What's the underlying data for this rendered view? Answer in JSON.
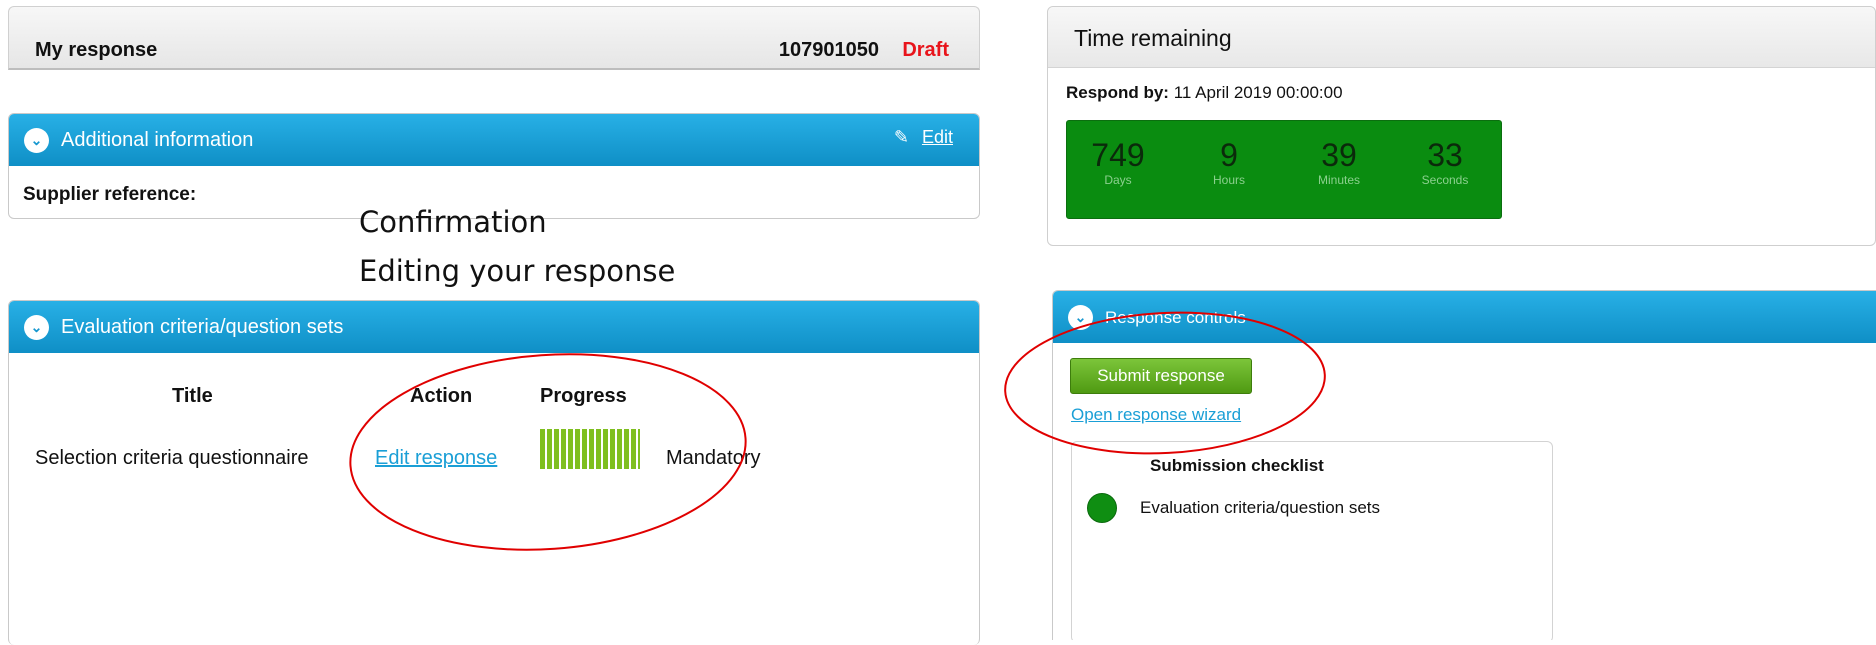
{
  "my_response": {
    "title": "My response",
    "number": "107901050",
    "status": "Draft"
  },
  "additional_info": {
    "title": "Additional information",
    "edit_label": "Edit",
    "supplier_label": "Supplier reference:"
  },
  "overlay": {
    "line1": "Confirmation",
    "line2": "Editing your response"
  },
  "evaluation": {
    "title": "Evaluation criteria/question sets",
    "columns": {
      "title": "Title",
      "action": "Action",
      "progress": "Progress"
    },
    "row": {
      "title": "Selection criteria questionnaire",
      "action": "Edit response",
      "status": "Mandatory",
      "progress_fraction": 1.0
    }
  },
  "time_remaining": {
    "title": "Time remaining",
    "respond_by_label": "Respond by:",
    "respond_by_value": "11 April 2019 00:00:00",
    "days": "749",
    "days_label": "Days",
    "hours": "9",
    "hours_label": "Hours",
    "minutes": "39",
    "minutes_label": "Minutes",
    "seconds": "33",
    "seconds_label": "Seconds"
  },
  "response_controls": {
    "title": "Response controls",
    "submit_label": "Submit response",
    "wizard_label": "Open response wizard",
    "checklist_title": "Submission checklist",
    "checklist_item": "Evaluation criteria/question sets"
  },
  "colors": {
    "panel_blue": "#1597cf",
    "draft_red": "#e8141b",
    "countdown_green": "#0a8c10",
    "progress_green": "#7fbf1f",
    "annotation_red": "#e00000"
  }
}
